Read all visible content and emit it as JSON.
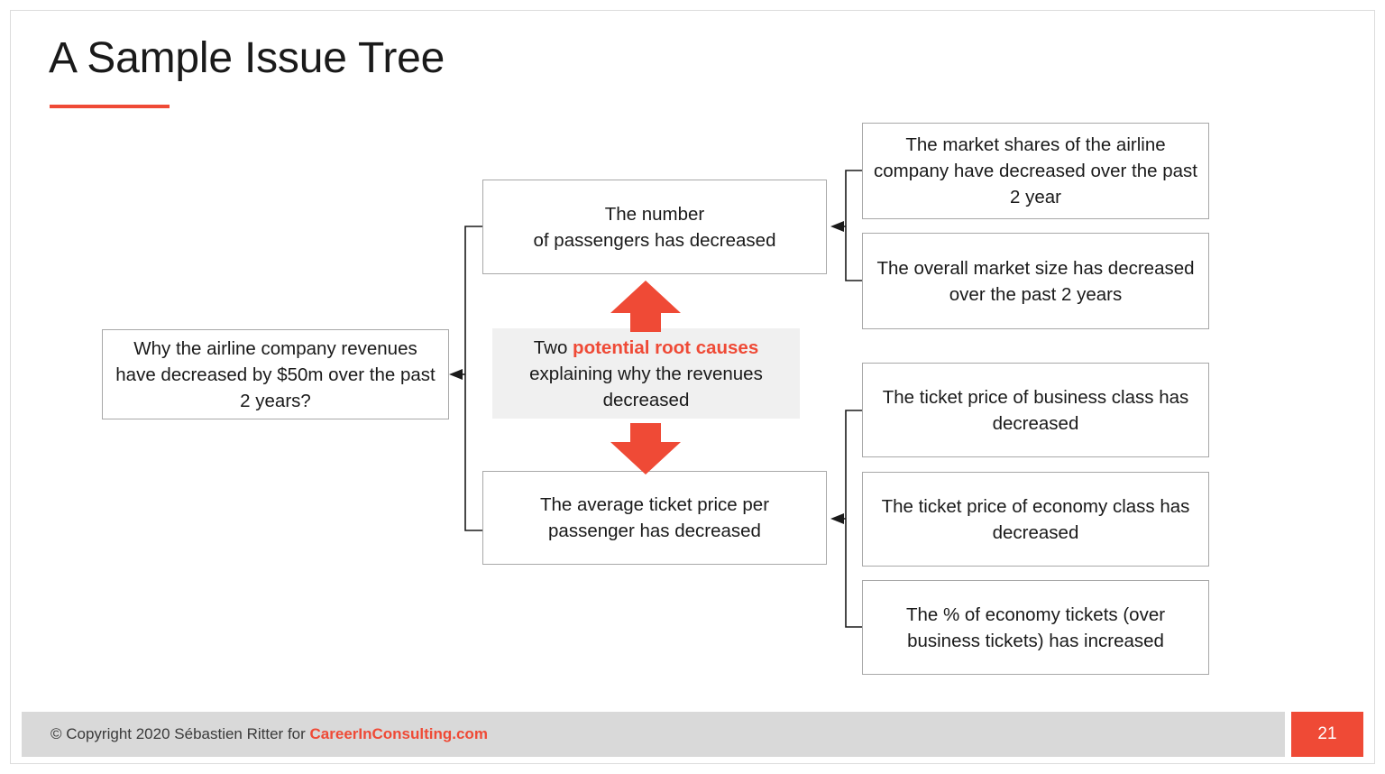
{
  "slide": {
    "title": "A Sample Issue Tree",
    "accent_color": "#ef4a36",
    "box_border_color": "#a8a8a8",
    "callout_background": "#f0f0f0",
    "footer_background": "#d9d9d9"
  },
  "tree": {
    "root": {
      "label": "Why the airline company revenues have decreased by $50m over the past 2 years?"
    },
    "callout": {
      "prefix": "Two ",
      "highlight": "potential root causes",
      "suffix": " explaining why the revenues decreased"
    },
    "branches": [
      {
        "label_line1": "The number",
        "label_line2": "of passengers has decreased",
        "children": [
          {
            "label": "The market shares of the airline company have decreased over the past 2 year"
          },
          {
            "label": "The overall market size has decreased over the past 2 years"
          }
        ]
      },
      {
        "label_line1": "The average ticket price per",
        "label_line2": "passenger has decreased",
        "children": [
          {
            "label": "The ticket price of business class has decreased"
          },
          {
            "label": "The ticket price of economy class has decreased"
          },
          {
            "label": "The % of economy tickets (over business tickets) has increased"
          }
        ]
      }
    ],
    "arrows": [
      {
        "name": "up-arrow",
        "direction": "up"
      },
      {
        "name": "down-arrow",
        "direction": "down"
      }
    ]
  },
  "footer": {
    "copyright_prefix": "© Copyright 2020 Sébastien Ritter for ",
    "site": "CareerInConsulting.com",
    "page_number": "21"
  }
}
